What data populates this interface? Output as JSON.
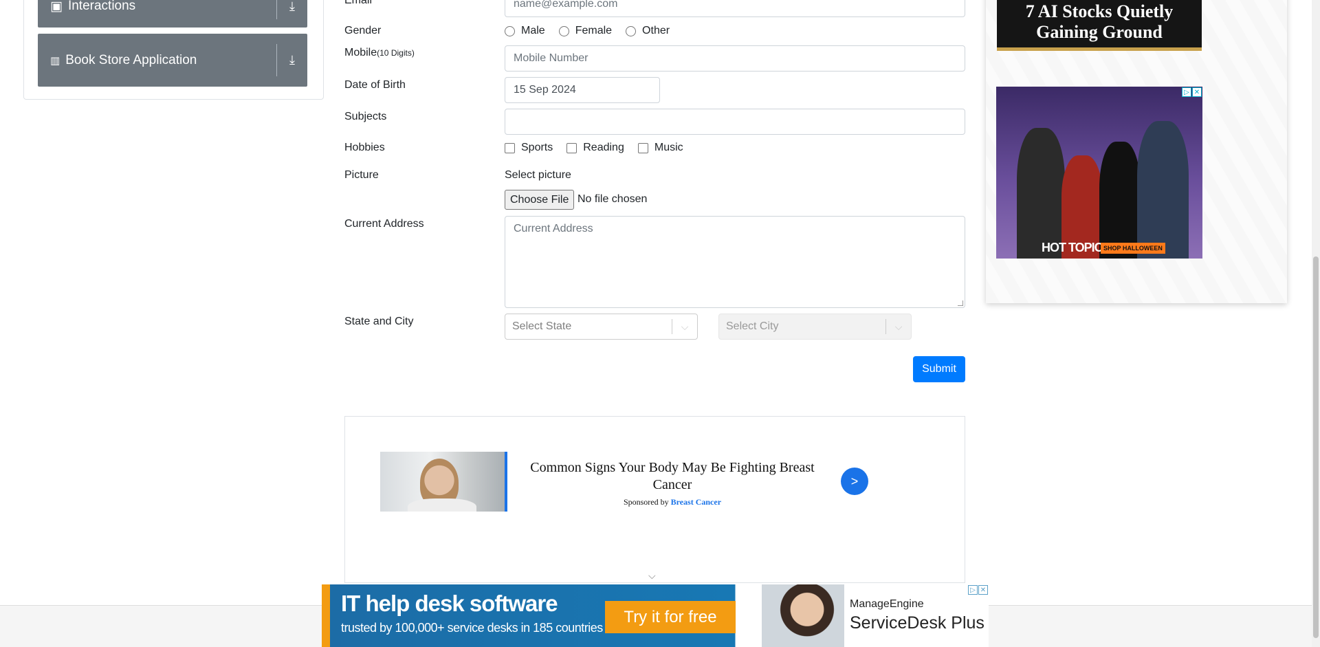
{
  "sidebar": {
    "items": [
      {
        "label": "Interactions",
        "icon": "interactions-icon"
      },
      {
        "label": "Book Store Application",
        "icon": "book-icon"
      }
    ]
  },
  "form": {
    "email": {
      "label": "Email",
      "placeholder": "name@example.com"
    },
    "gender": {
      "label": "Gender",
      "options": [
        "Male",
        "Female",
        "Other"
      ]
    },
    "mobile": {
      "label": "Mobile",
      "hint": "(10 Digits)",
      "placeholder": "Mobile Number"
    },
    "dob": {
      "label": "Date of Birth",
      "value": "15 Sep 2024"
    },
    "subjects": {
      "label": "Subjects",
      "value": ""
    },
    "hobbies": {
      "label": "Hobbies",
      "options": [
        "Sports",
        "Reading",
        "Music"
      ]
    },
    "picture": {
      "label": "Picture",
      "select_label": "Select picture",
      "button": "Choose File",
      "status": "No file chosen"
    },
    "address": {
      "label": "Current Address",
      "placeholder": "Current Address"
    },
    "state_city": {
      "label": "State and City",
      "state_placeholder": "Select State",
      "city_placeholder": "Select City"
    },
    "submit": "Submit"
  },
  "native_ad": {
    "title": "Common Signs Your Body May Be Fighting Breast Cancer",
    "sponsored_by": "Sponsored by",
    "sponsor": "Breast Cancer",
    "go": ">"
  },
  "right_ads": {
    "ad1_headline": "7 AI Stocks Quietly Gaining Ground",
    "ad2_brand": "HOT TOPIC",
    "ad2_cta": "SHOP HALLOWEEN"
  },
  "banner": {
    "headline": "IT help desk software",
    "subline": "trusted by 100,000+ service desks in 185 countries",
    "cta": "Try it for free",
    "brand_top": "ManageEngine",
    "brand_product": "ServiceDesk Plus"
  },
  "colors": {
    "primary": "#007bff",
    "sidebar": "#6c757d",
    "cta_orange": "#f39c12"
  }
}
